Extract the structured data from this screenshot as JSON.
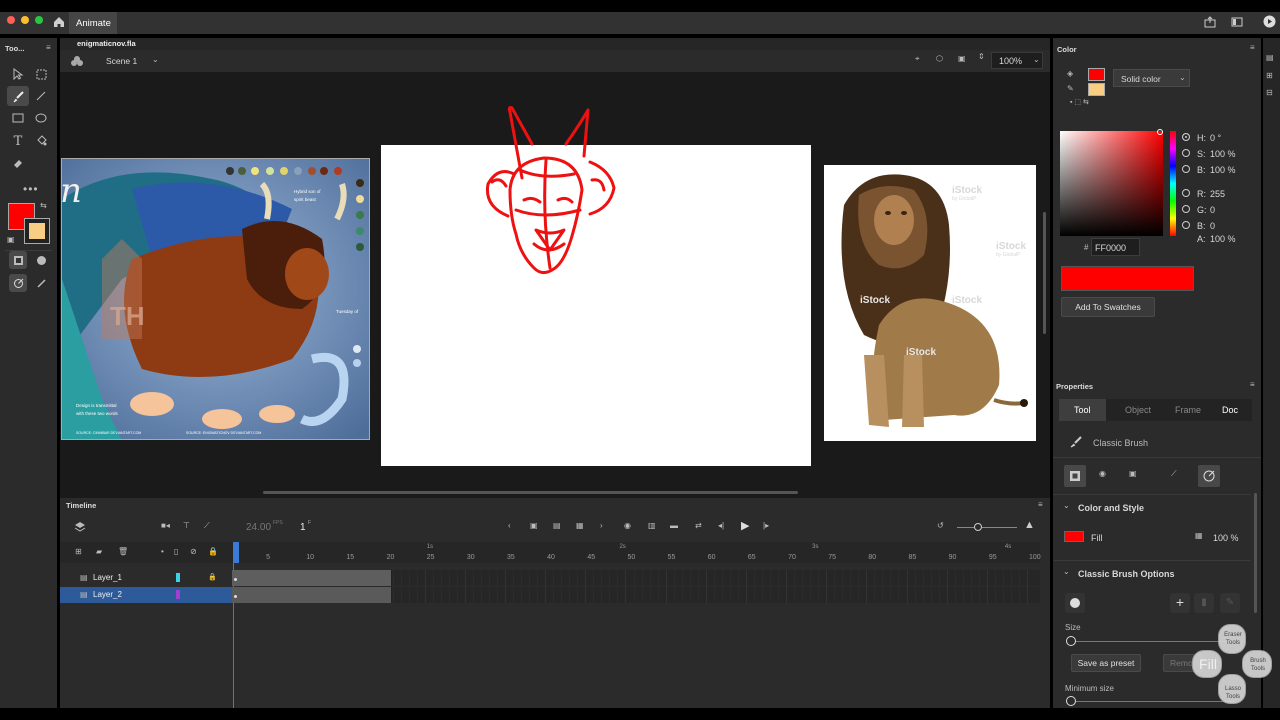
{
  "app": {
    "name": "Animate"
  },
  "document": {
    "tab": "enigmaticnov.fla",
    "scene": "Scene 1",
    "zoom": "100%"
  },
  "toolbar": {
    "title": "Too..."
  },
  "colors": {
    "stroke": "#FF0000",
    "fill": "#F7CE84",
    "accent": "#FF0000"
  },
  "color_panel": {
    "title": "Color",
    "type": "Solid color",
    "hsb": {
      "h_label": "H:",
      "h_value": "0 °",
      "s_label": "S:",
      "s_value": "100 %",
      "b_label": "B:",
      "b_value": "100 %"
    },
    "rgb": {
      "r_label": "R:",
      "r_value": "255",
      "g_label": "G:",
      "g_value": "0",
      "b_label": "B:",
      "b_value": "0"
    },
    "alpha": {
      "label": "A:",
      "value": "100 %"
    },
    "hex_label": "#",
    "hex_value": "FF0000",
    "add_swatch": "Add To Swatches"
  },
  "properties": {
    "title": "Properties",
    "tabs": [
      "Tool",
      "Object",
      "Frame",
      "Doc"
    ],
    "tool_name": "Classic Brush",
    "color_style": {
      "title": "Color and Style",
      "fill_label": "Fill",
      "fill_alpha": "100 %"
    },
    "brush_options": {
      "title": "Classic Brush Options",
      "size_label": "Size",
      "size_value": 0.03,
      "save_preset": "Save as preset",
      "remove": "Remo",
      "min_size_label": "Minimum size",
      "min_size_value": 0.03
    }
  },
  "timeline": {
    "title": "Timeline",
    "fps": "24.00",
    "fps_unit": "FPS",
    "frame": "1",
    "frame_unit": "F",
    "seconds": [
      "1s",
      "2s",
      "3s",
      "4s"
    ],
    "ruler": [
      "1",
      "5",
      "10",
      "15",
      "20",
      "25",
      "30",
      "35",
      "40",
      "45",
      "50",
      "55",
      "60",
      "65",
      "70",
      "75",
      "80",
      "85",
      "90",
      "95",
      "100"
    ],
    "layers": [
      {
        "name": "Layer_1",
        "color": "#39d4e8",
        "locked": true
      },
      {
        "name": "Layer_2",
        "color": "#a040d0",
        "locked": false,
        "selected": true
      }
    ]
  },
  "pie_menu": {
    "center": "Fill",
    "top": "Eraser Tools",
    "right": "Brush Tools",
    "bottom": "Lasso Tools"
  },
  "lion_image": {
    "watermarks": [
      "iStock",
      "iStock",
      "iStock",
      "iStock",
      "iStock"
    ],
    "credit": "by GlobalP",
    "credit_b": "by GlobalP"
  },
  "ref_image": {
    "letter": "n",
    "logo": "TH",
    "text_a": "Hybrid son of",
    "text_b": "spirit beast",
    "text_c": "Tuesday of",
    "text_d": "Design is transmittal",
    "text_e": "with these two words",
    "footer_a": "SOURCE: CINNIBAR DEVIANTART.COM",
    "footer_b": "SOURCE: ENIGMATICNOV DEVIANTART.COM"
  }
}
